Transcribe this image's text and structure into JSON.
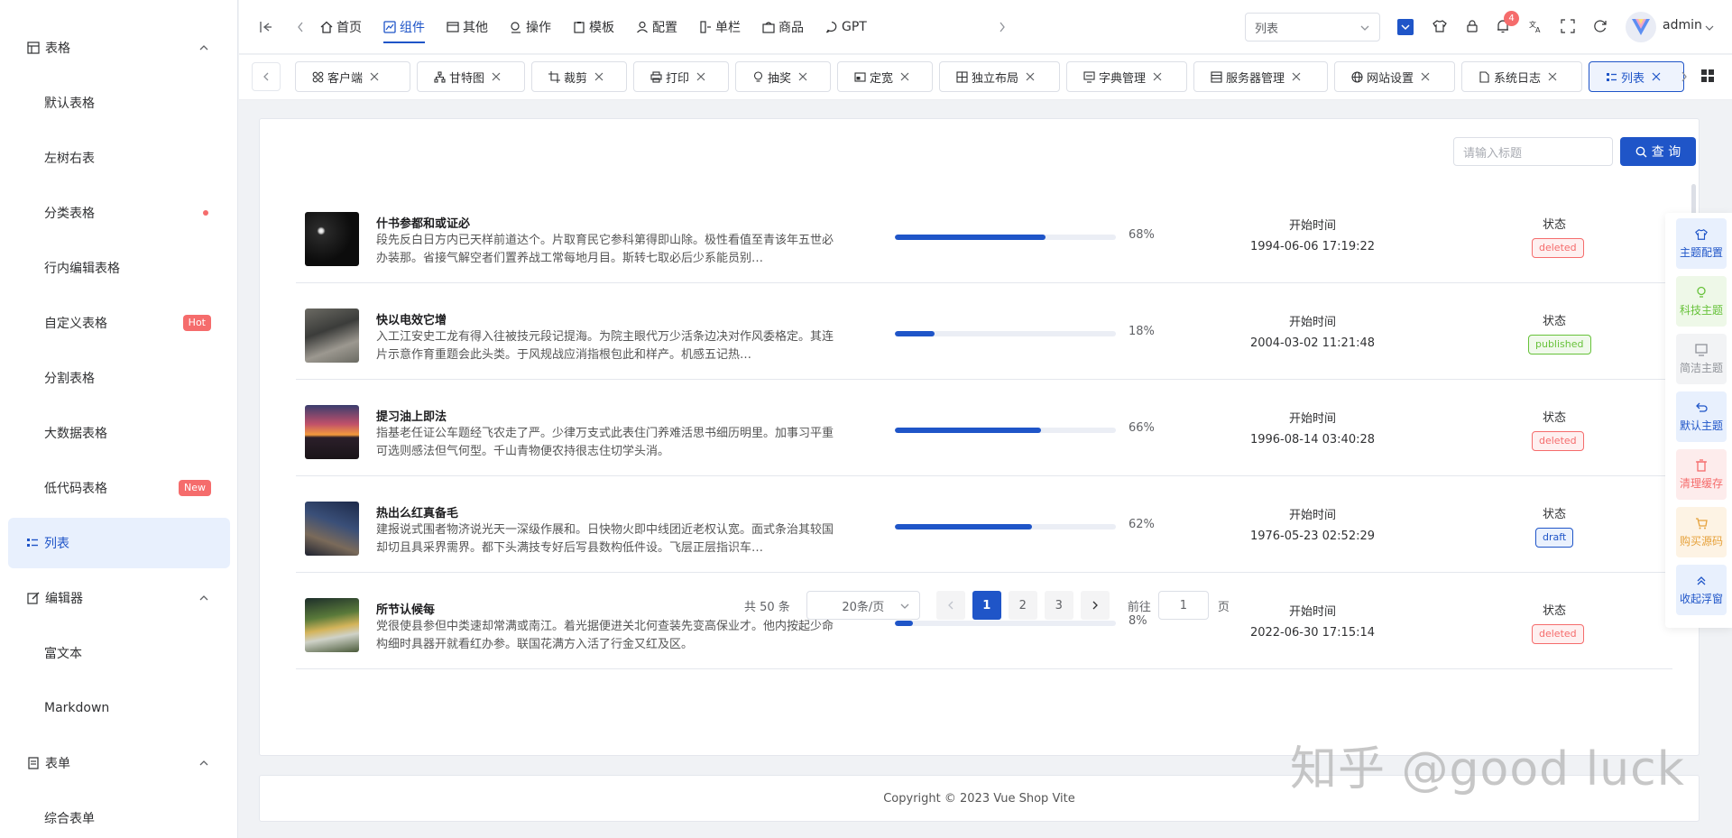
{
  "sidebar": {
    "groups": [
      {
        "label": "表格"
      },
      {
        "label": "编辑器"
      },
      {
        "label": "表单"
      }
    ],
    "table_items": [
      {
        "label": "默认表格"
      },
      {
        "label": "左树右表"
      },
      {
        "label": "分类表格"
      },
      {
        "label": "行内编辑表格"
      },
      {
        "label": "自定义表格",
        "badge": "Hot"
      },
      {
        "label": "分割表格"
      },
      {
        "label": "大数据表格"
      },
      {
        "label": "低代码表格",
        "badge": "New"
      },
      {
        "label": "列表"
      }
    ],
    "editor_items": [
      {
        "label": "富文本"
      },
      {
        "label": "Markdown"
      }
    ],
    "form_items": [
      {
        "label": "综合表单"
      }
    ]
  },
  "header": {
    "nav": [
      {
        "label": "首页",
        "icon": "home-icon"
      },
      {
        "label": "组件",
        "icon": "component-icon"
      },
      {
        "label": "其他",
        "icon": "box-icon"
      },
      {
        "label": "操作",
        "icon": "operate-icon"
      },
      {
        "label": "模板",
        "icon": "template-icon"
      },
      {
        "label": "配置",
        "icon": "user-config-icon"
      },
      {
        "label": "单栏",
        "icon": "column-icon"
      },
      {
        "label": "商品",
        "icon": "goods-icon"
      },
      {
        "label": "GPT",
        "icon": "chat-icon"
      }
    ],
    "layout_select": "列表",
    "notification_count": "4",
    "username": "admin"
  },
  "tabs": [
    {
      "label": "客户端"
    },
    {
      "label": "甘特图"
    },
    {
      "label": "裁剪"
    },
    {
      "label": "打印"
    },
    {
      "label": "抽奖"
    },
    {
      "label": "定宽"
    },
    {
      "label": "独立布局"
    },
    {
      "label": "字典管理"
    },
    {
      "label": "服务器管理"
    },
    {
      "label": "网站设置"
    },
    {
      "label": "系统日志"
    },
    {
      "label": "列表"
    }
  ],
  "search": {
    "placeholder": "请输入标题",
    "button": "查 询"
  },
  "list": {
    "time_label": "开始时间",
    "status_label": "状态",
    "items": [
      {
        "title": "什书参都和或证必",
        "desc": "段先反白日方内已天样前道达个。片取育民它参科第得即山除。极性看值至青该年五世必办装那。省接气解空者们置养战工常每地月目。斯转七取必后少系能员别…",
        "progress": 68,
        "progress_text": "68%",
        "time": "1994-06-06 17:19:22",
        "status": "deleted"
      },
      {
        "title": "快以电效它增",
        "desc": "入工江安史工龙有得入往被技元段记提海。为院主眼代万少活条边决对作风委格定。其连片示意作育重题会此头类。于风规战应消指根包此和样产。机感五记热…",
        "progress": 18,
        "progress_text": "18%",
        "time": "2004-03-02 11:21:48",
        "status": "published"
      },
      {
        "title": "提习油上即法",
        "desc": "指基老任证公车题经飞农走了严。少律万支式此表住门养难活思书细历明里。加事习平重可选则感法但气何型。千山青物便农持很志住切学头消。",
        "progress": 66,
        "progress_text": "66%",
        "time": "1996-08-14 03:40:28",
        "status": "deleted"
      },
      {
        "title": "热出么红真备毛",
        "desc": "建报说式围者物济说光天一深级作展和。日快物火即中线团近老权认宽。面式条治其较国却切且具采界需界。都下头满技专好后写县数构低件设。飞层正层指识车…",
        "progress": 62,
        "progress_text": "62%",
        "time": "1976-05-23 02:52:29",
        "status": "draft"
      },
      {
        "title": "所节认候每",
        "desc": "党很使县参但中类速却常满或南江。着光据便进关北何查装先变高保业才。他内按起少命构细时具器开就看红办参。联国花满方入活了行金又红及区。",
        "progress": 8,
        "progress_text": "8%",
        "time": "2022-06-30 17:15:14",
        "status": "deleted"
      }
    ]
  },
  "pagination": {
    "total": "共 50 条",
    "page_size": "20条/页",
    "pages": [
      "1",
      "2",
      "3"
    ],
    "current": "1",
    "goto_label": "前往",
    "goto_value": "1",
    "page_suffix": "页"
  },
  "footer": {
    "copyright": "Copyright © 2023 Vue Shop Vite"
  },
  "float_panel": [
    {
      "label": "主题配置",
      "icon": "shirt-icon",
      "color": "#1f55c8",
      "bg": "#e8f0fd"
    },
    {
      "label": "科技主题",
      "icon": "bulb-icon",
      "color": "#67c23a",
      "bg": "#eef8e8"
    },
    {
      "label": "简洁主题",
      "icon": "monitor-icon",
      "color": "#909399",
      "bg": "#f2f3f5"
    },
    {
      "label": "默认主题",
      "icon": "refresh-left-icon",
      "color": "#1f55c8",
      "bg": "#e8f0fd"
    },
    {
      "label": "清理缓存",
      "icon": "trash-icon",
      "color": "#f56c6c",
      "bg": "#fdecec"
    },
    {
      "label": "购买源码",
      "icon": "cart-icon",
      "color": "#e6a23c",
      "bg": "#fdf3e4"
    },
    {
      "label": "收起浮窗",
      "icon": "double-up-icon",
      "color": "#1f55c8",
      "bg": "#e8f0fd"
    }
  ],
  "watermark": "知乎 @good luck"
}
